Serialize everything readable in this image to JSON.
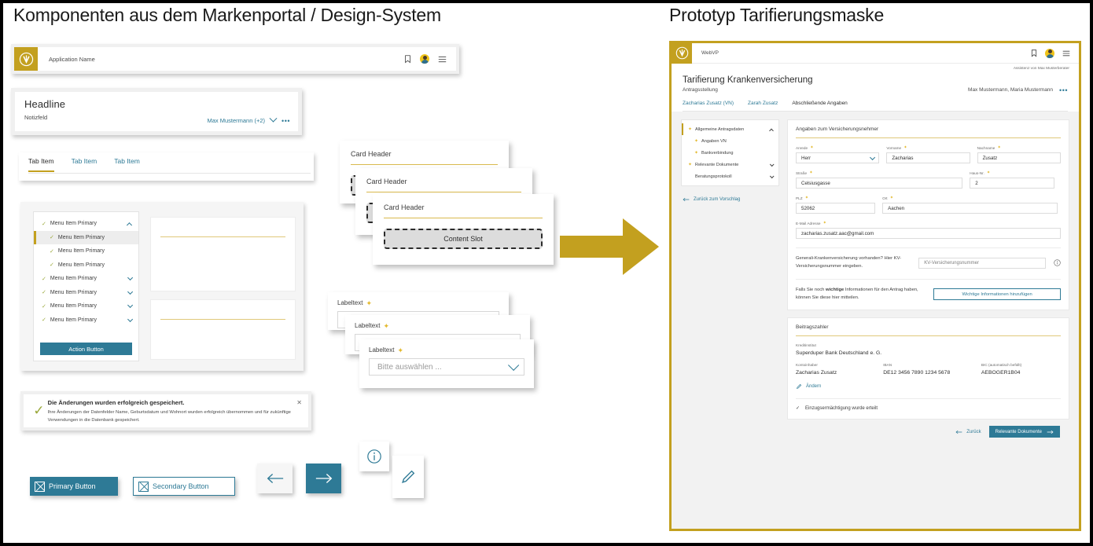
{
  "colors": {
    "gold": "#c3a01f",
    "teal": "#2e7a96",
    "green": "#9aa83a",
    "star": "#e3b92e"
  },
  "left": {
    "title": "Komponenten aus dem Markenportal / Design-System",
    "appbar": {
      "app_name": "Application Name",
      "icons": [
        "bookmark-icon",
        "avatar",
        "hamburger-icon"
      ]
    },
    "headline_card": {
      "headline": "Headline",
      "subtitle": "Notizfeld",
      "assignee": "Max Mustermann (+2)",
      "more": "•••"
    },
    "tabs": [
      {
        "label": "Tab Item",
        "active": true
      },
      {
        "label": "Tab Item",
        "active": false
      },
      {
        "label": "Tab Item",
        "active": false
      }
    ],
    "menu": {
      "items": [
        {
          "label": "Menu Item Primary",
          "level": 0,
          "selected": false,
          "chevron": "up"
        },
        {
          "label": "Menu Item Primary",
          "level": 1,
          "selected": true,
          "chevron": ""
        },
        {
          "label": "Menu Item Primary",
          "level": 1,
          "selected": false,
          "chevron": ""
        },
        {
          "label": "Menu Item Primary",
          "level": 1,
          "selected": false,
          "chevron": ""
        },
        {
          "label": "Menu Item Primary",
          "level": 0,
          "selected": false,
          "chevron": "down"
        },
        {
          "label": "Menu Item Primary",
          "level": 0,
          "selected": false,
          "chevron": "down"
        },
        {
          "label": "Menu Item Primary",
          "level": 0,
          "selected": false,
          "chevron": "down"
        },
        {
          "label": "Menu Item Primary",
          "level": 0,
          "selected": false,
          "chevron": "down"
        }
      ],
      "action_button": "Action Button"
    },
    "cards": [
      {
        "header": "Card Header"
      },
      {
        "header": "Card Header"
      },
      {
        "header": "Card Header",
        "content_slot": "Content Slot"
      }
    ],
    "label_fields": [
      {
        "label": "Labeltext",
        "required": true,
        "value": ""
      },
      {
        "label": "Labeltext",
        "required": true,
        "value": ""
      },
      {
        "label": "Labeltext",
        "required": true,
        "placeholder": "Bitte auswählen  ..."
      }
    ],
    "notification": {
      "title": "Die Änderungen wurden erfolgreich gespeichert.",
      "body": "Ihre Änderungen der Datenfelder Name, Geburtsdatum und Wohnort wurden erfolgreich übernommen und für zukünftige Verwendungen in die Datenbank gespeichert.",
      "close": "✕"
    },
    "buttons": {
      "primary": "Primary Button",
      "secondary": "Secondary Button",
      "back_icon": "arrow-left-icon",
      "next_icon": "arrow-right-icon",
      "info_icon": "info-icon",
      "edit_icon": "pencil-icon"
    }
  },
  "arrow": {
    "name": "flow-arrow-right",
    "color": "#c3a01f"
  },
  "right": {
    "title": "Prototyp Tarifierungsmaske",
    "appbar": {
      "app_name": "WebVP"
    },
    "assistant_line": "Assistenz von Max Musterberater",
    "page_title": "Tarifierung Krankenversicherung",
    "page_subtitle": "Antragsstellung",
    "page_persons": "Max Mustermann, Maria Mustermann",
    "page_more": "•••",
    "tabs": [
      {
        "label": "Zacharias Zusatz (VN)",
        "active": false
      },
      {
        "label": "Zarah Zusatz",
        "active": false
      },
      {
        "label": "Abschließende Angaben",
        "active": true
      }
    ],
    "sidebar": {
      "items": [
        {
          "label": "Allgemeine Antragsdaten",
          "star": true,
          "level": 0,
          "selected": true,
          "chevron": "up"
        },
        {
          "label": "Angaben VN",
          "star": true,
          "level": 1,
          "selected": false,
          "chevron": ""
        },
        {
          "label": "Bankverbindung",
          "star": true,
          "level": 1,
          "selected": false,
          "chevron": ""
        },
        {
          "label": "Relevante Dokumente",
          "star": true,
          "level": 0,
          "selected": false,
          "chevron": "down"
        },
        {
          "label": "Beratungsprotokoll",
          "star": false,
          "level": 0,
          "selected": false,
          "chevron": "down"
        }
      ],
      "back_link": "Zurück zum Vorschlag"
    },
    "card_vn": {
      "title": "Angaben zum Versicherungsnehmer",
      "fields": [
        {
          "label": "Anrede",
          "required": true,
          "value": "Herr",
          "type": "select"
        },
        {
          "label": "Vorname",
          "required": true,
          "value": "Zacharias",
          "type": "text"
        },
        {
          "label": "Nachname",
          "required": true,
          "value": "Zusatz",
          "type": "text"
        },
        {
          "label": "Straße",
          "required": true,
          "value": "Celsiusgasse",
          "type": "text"
        },
        {
          "label": "Haus-Nr.",
          "required": true,
          "value": "2",
          "type": "text"
        },
        {
          "label": "PLZ",
          "required": true,
          "value": "52062",
          "type": "text"
        },
        {
          "label": "Ort",
          "required": true,
          "value": "Aachen",
          "type": "text"
        },
        {
          "label": "E-Mail Adresse",
          "required": true,
          "value": "zacharias.zusatz.aac@gmail.com",
          "type": "text"
        }
      ],
      "kv_question": "Generali-Krankenversicherung vorhanden? Hier KV-Versicherungsnummer eingeben.",
      "kv_placeholder": "KV-Versicherungsnummer",
      "info_icon": "info-icon",
      "important_text_1": "Falls Sie noch ",
      "important_text_bold": "wichtige",
      "important_text_2": " Informationen für den Antrag haben, können Sie diese hier mitteilen.",
      "important_button": "Wichtige Informationen hinzufügen"
    },
    "card_payer": {
      "title": "Beitragszahler",
      "bank_label": "Kreditinstitut",
      "bank_value": "Superduper Bank Deutschland e. G.",
      "cols": [
        {
          "key": "Kontoinhaber",
          "value": "Zacharias Zusatz"
        },
        {
          "key": "IBAN",
          "value": "DE12 3456 7890 1234 5678"
        },
        {
          "key": "BIC (automatisch befüllt)",
          "value": "AEBOGER1B04"
        }
      ],
      "edit_link": "Ändern",
      "mandate": "Einzugsermächtigung wurde erteilt"
    },
    "footer": {
      "back": "Zurück",
      "next": "Relevante Dokumente"
    }
  }
}
